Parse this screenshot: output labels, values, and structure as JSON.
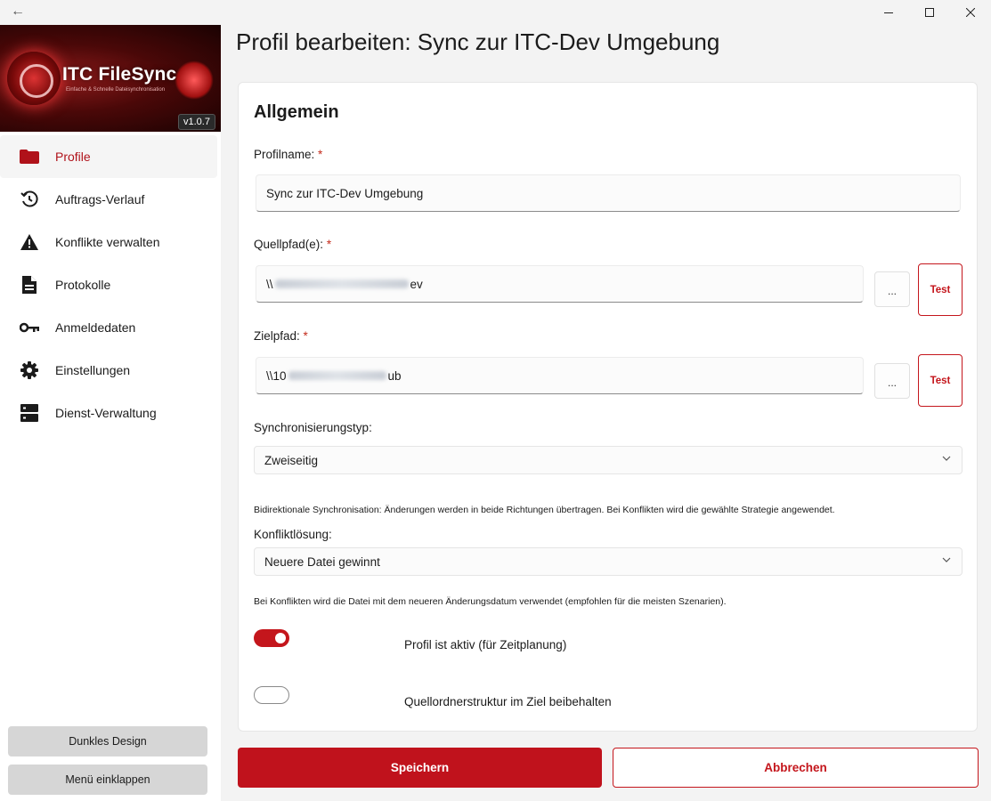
{
  "titlebar": {
    "back_glyph": "←"
  },
  "logo": {
    "brand": "ITC FileSync",
    "tagline": "Einfache & Schnelle Dateisynchronisation",
    "version": "v1.0.7"
  },
  "nav": [
    {
      "label": "Profile",
      "icon": "folder-icon",
      "active": true
    },
    {
      "label": "Auftrags-Verlauf",
      "icon": "history-icon"
    },
    {
      "label": "Konflikte verwalten",
      "icon": "warning-icon"
    },
    {
      "label": "Protokolle",
      "icon": "document-icon"
    },
    {
      "label": "Anmeldedaten",
      "icon": "key-icon"
    },
    {
      "label": "Einstellungen",
      "icon": "gear-icon"
    },
    {
      "label": "Dienst-Verwaltung",
      "icon": "server-icon"
    }
  ],
  "sidebar_bottom": {
    "theme_label": "Dunkles Design",
    "collapse_label": "Menü einklappen"
  },
  "page": {
    "title": "Profil bearbeiten: Sync zur ITC-Dev Umgebung"
  },
  "form": {
    "section_title": "Allgemein",
    "required_mark": "*",
    "profile_name_label": "Profilname:",
    "profile_name_value": "Sync zur ITC-Dev Umgebung",
    "source_label": "Quellpfad(e):",
    "source_prefix": "\\\\",
    "source_suffix": "ev",
    "target_label": "Zielpfad:",
    "target_prefix": "\\\\10",
    "target_suffix": "ub",
    "browse_label": "...",
    "test_label": "Test",
    "sync_type_label": "Synchronisierungstyp:",
    "sync_type_value": "Zweiseitig",
    "sync_type_hint": "Bidirektionale Synchronisation: Änderungen werden in beide Richtungen übertragen. Bei Konflikten wird die gewählte Strategie angewendet.",
    "conflict_label": "Konfliktlösung:",
    "conflict_value": "Neuere Datei gewinnt",
    "conflict_hint": "Bei Konflikten wird die Datei mit dem neueren Änderungsdatum verwendet (empfohlen für die meisten Szenarien).",
    "toggle_active_label": "Profil ist aktiv (für Zeitplanung)",
    "toggle_active_on": true,
    "toggle_structure_label": "Quellordnerstruktur im Ziel beibehalten",
    "toggle_structure_on": false
  },
  "actions": {
    "save_label": "Speichern",
    "cancel_label": "Abbrechen"
  },
  "colors": {
    "accent": "#c0121c",
    "sidebar_bg": "#ffffff",
    "page_bg": "#f3f3f3"
  }
}
